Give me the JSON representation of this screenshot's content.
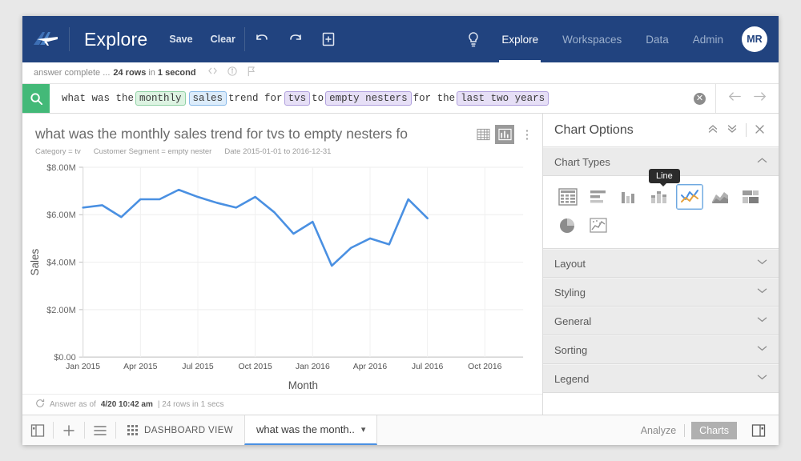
{
  "topnav": {
    "logo_icon": "airplane-logo-icon",
    "brand": "Explore",
    "save_label": "Save",
    "clear_label": "Clear",
    "undo_icon": "undo-icon",
    "redo_icon": "redo-icon",
    "new_icon": "new-answer-icon",
    "bulb_icon": "lightbulb-icon",
    "items": [
      {
        "label": "Explore",
        "active": true
      },
      {
        "label": "Workspaces",
        "active": false
      },
      {
        "label": "Data",
        "active": false
      },
      {
        "label": "Admin",
        "active": false
      }
    ],
    "avatar_initials": "MR",
    "bg_color": "#21437f"
  },
  "status_strip": {
    "prefix": "answer complete ...",
    "rows": "24 rows",
    "middle": "in",
    "duration": "1 second",
    "icons": [
      "code-icon",
      "info-icon",
      "flag-icon"
    ]
  },
  "search": {
    "icon": "search-icon",
    "icon_bg": "#43b978",
    "tokens": [
      {
        "text": "what was the ",
        "type": "plain"
      },
      {
        "text": "monthly",
        "type": "green"
      },
      {
        "text": " ",
        "type": "plain"
      },
      {
        "text": "sales",
        "type": "blue"
      },
      {
        "text": " trend for ",
        "type": "plain"
      },
      {
        "text": "tvs",
        "type": "purp"
      },
      {
        "text": " to ",
        "type": "plain"
      },
      {
        "text": "empty nesters",
        "type": "purp"
      },
      {
        "text": " for the ",
        "type": "plain"
      },
      {
        "text": "last two years",
        "type": "purp"
      }
    ],
    "clear_label": "✕",
    "back_icon": "arrow-left-icon",
    "forward_icon": "arrow-right-icon"
  },
  "viz": {
    "title": "what was the monthly sales trend for tvs to empty nesters fo",
    "table_icon": "table-view-icon",
    "chart_icon": "chart-view-icon",
    "kebab_icon": "more-options-icon",
    "filters": [
      "Category = tv",
      "Customer Segment = empty nester",
      "Date 2015-01-01 to 2016-12-31"
    ],
    "footer": {
      "refresh_icon": "refresh-icon",
      "prefix": "Answer as of",
      "timestamp": "4/20 10:42 am",
      "suffix": "| 24 rows in 1 secs"
    }
  },
  "chart_data": {
    "type": "line",
    "title": "",
    "xlabel": "Month",
    "ylabel": "Sales",
    "ylim": [
      0,
      8000000
    ],
    "ytick_labels": [
      "$0.00",
      "$2.00M",
      "$4.00M",
      "$6.00M",
      "$8.00M"
    ],
    "ytick_values": [
      0,
      2000000,
      4000000,
      6000000,
      8000000
    ],
    "xtick_labels": [
      "Jan 2015",
      "Apr 2015",
      "Jul 2015",
      "Oct 2015",
      "Jan 2016",
      "Apr 2016",
      "Jul 2016",
      "Oct 2016"
    ],
    "xtick_indices": [
      0,
      3,
      6,
      9,
      12,
      15,
      18,
      21
    ],
    "x_slots": 24,
    "grid": true,
    "legend": "none",
    "line_color": "#4a90e2",
    "x": [
      "Jan 2015",
      "Feb 2015",
      "Mar 2015",
      "Apr 2015",
      "May 2015",
      "Jun 2015",
      "Jul 2015",
      "Aug 2015",
      "Sep 2015",
      "Oct 2015",
      "Nov 2015",
      "Dec 2015",
      "Jan 2016",
      "Feb 2016",
      "Mar 2016",
      "Apr 2016",
      "May 2016",
      "Jun 2016",
      "Jul 2016"
    ],
    "values": [
      6300000,
      6400000,
      5900000,
      6650000,
      6650000,
      7050000,
      6750000,
      6500000,
      6300000,
      6750000,
      6100000,
      5200000,
      5700000,
      3850000,
      4600000,
      5000000,
      4750000,
      6650000,
      5850000
    ]
  },
  "options": {
    "title": "Chart Options",
    "collapse_icon": "collapse-all-icon",
    "expand_icon": "expand-all-icon",
    "close_icon": "close-icon",
    "chart_types_label": "Chart Types",
    "tooltip": "Line",
    "types": [
      {
        "name": "table-chart-icon",
        "selected": false
      },
      {
        "name": "horizontal-bar-chart-icon",
        "selected": false
      },
      {
        "name": "column-chart-icon",
        "selected": false
      },
      {
        "name": "stacked-column-chart-icon",
        "selected": false
      },
      {
        "name": "line-chart-icon",
        "selected": true
      },
      {
        "name": "area-chart-icon",
        "selected": false
      },
      {
        "name": "treemap-chart-icon",
        "selected": false
      },
      {
        "name": "pie-chart-icon",
        "selected": false
      },
      {
        "name": "scatter-chart-icon",
        "selected": false
      }
    ],
    "sections": [
      {
        "label": "Layout"
      },
      {
        "label": "Styling"
      },
      {
        "label": "General"
      },
      {
        "label": "Sorting"
      },
      {
        "label": "Legend"
      }
    ]
  },
  "bottombar": {
    "panel_icon": "toggle-left-panel-icon",
    "add_icon": "add-tab-icon",
    "list_icon": "list-view-icon",
    "grid_icon": "grid-dots-icon",
    "dashboard_label": "DASHBOARD VIEW",
    "active_tab": "what was the month..",
    "tab_caret": "▾",
    "analyze_label": "Analyze",
    "charts_label": "Charts",
    "right_panel_icon": "toggle-right-panel-icon"
  }
}
